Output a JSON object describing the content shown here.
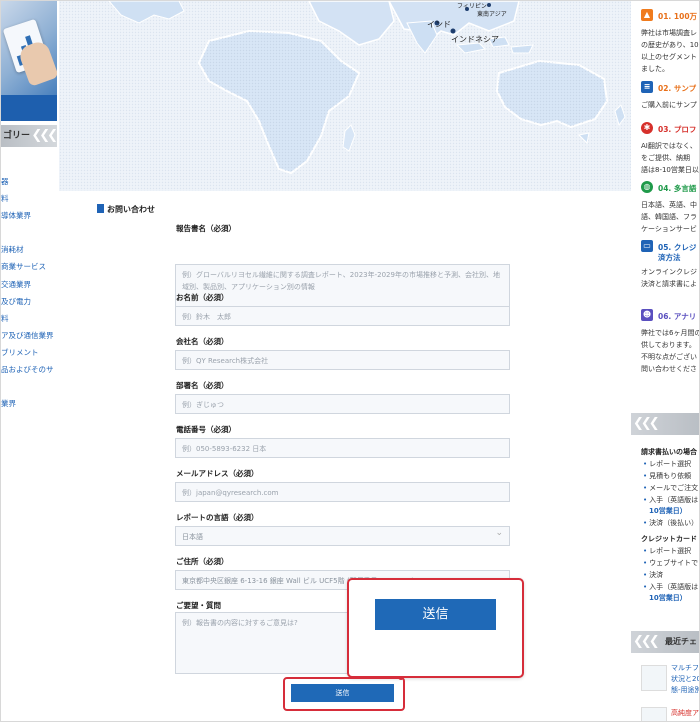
{
  "left": {
    "category_title": "ゴリー",
    "categories": [
      "器",
      "料",
      "導体業界",
      "",
      "消耗材",
      "商業サービス",
      "交通業界",
      "及び電力",
      "料",
      "ア及び通信業界",
      "ブリメント",
      "品およびそのサ",
      "",
      "業界"
    ]
  },
  "map": {
    "label_india": "インド",
    "label_indonesia": "インドネシア",
    "label_top1": "フィリピン",
    "label_top2": "東南アジア"
  },
  "form": {
    "section_title": "お問い合わせ",
    "fields": [
      {
        "label": "報告書名（必須）",
        "placeholder": "例）グローバルリヨセル繊維に関する調査レポート、2023年-2029年の市場推移と予測、会社別、地域別、製品別、アプリケーション別の情報"
      },
      {
        "label": "お名前（必須）",
        "placeholder": "例）鈴木　太郎"
      },
      {
        "label": "会社名（必須）",
        "placeholder": "例）QY Research株式会社"
      },
      {
        "label": "部署名（必須）",
        "placeholder": "例）ぎじゅつ"
      },
      {
        "label": "電話番号（必須）",
        "placeholder": "例）050-5893-6232 日本"
      },
      {
        "label": "メールアドレス（必須）",
        "placeholder": "例）japan@qyresearch.com"
      },
      {
        "label": "レポートの言語（必須）",
        "value": "日本語"
      },
      {
        "label": "ご住所（必須）",
        "value": "東京都中央区銀座 6-13-16 銀座 Wall ビル UCF5階 (郵便番号104-0061)"
      },
      {
        "label": "ご要望・質問",
        "placeholder": "例）報告書の内容に対するご意見は?"
      }
    ],
    "submit_label": "送信",
    "zoom_submit_label": "送信"
  },
  "right": {
    "features": [
      {
        "icon": "chart-icon",
        "color": "#f07b1d",
        "title": "01. 100万",
        "title_color": "#e8701a",
        "desc": [
          "弊社は市場調査レ",
          "の歴史があり、10",
          "以上のセグメント",
          "ました。"
        ]
      },
      {
        "icon": "document-icon",
        "color": "#1f63b6",
        "title": "02. サンプ",
        "title_color": "#e8701a",
        "desc": [
          "ご購入前にサンプ"
        ]
      },
      {
        "icon": "ai-icon",
        "color": "#d6302b",
        "title": "03. プロフ",
        "title_color": "#d6302b",
        "desc": [
          "AI翻訳ではなく、",
          "をご提供、納期",
          "語は8-10営業日以"
        ]
      },
      {
        "icon": "globe-icon",
        "color": "#1f9a4a",
        "title": "04. 多言語",
        "title_color": "#1f9a4a",
        "desc": [
          "日本語、英語、中",
          "語、韓国語、フラ",
          "ケーションサービ"
        ]
      },
      {
        "icon": "card-icon",
        "color": "#1f63b6",
        "title": "05. クレジ",
        "title_color": "#1f63b6",
        "title2": "済方法",
        "desc": [
          "オンラインクレジ",
          "決済と請求書によ"
        ]
      },
      {
        "icon": "analyst-icon",
        "color": "#5a4fbf",
        "title": "06. アナリ",
        "title_color": "#5a4fbf",
        "desc": [
          "弊社では6ヶ月間の",
          "供しております。",
          "不明な点がござい",
          "問い合わせくださ"
        ]
      }
    ],
    "payment_band": "",
    "invoice_head": "請求書払いの場合",
    "invoice_items": [
      "レポート選択",
      "見積もり依頼",
      "メールでご注文",
      "入手（英語版は",
      "10営業日）",
      "決済（後払い）"
    ],
    "card_head": "クレジットカード",
    "card_items": [
      "レポート選択",
      "ウェブサイトで",
      "決済",
      "入手（英語版は",
      "10営業日）"
    ],
    "recent_band": "最近チェ",
    "recent_items": [
      "マルチフ",
      "状況と20",
      "態-用途別",
      "高純度ア"
    ]
  }
}
